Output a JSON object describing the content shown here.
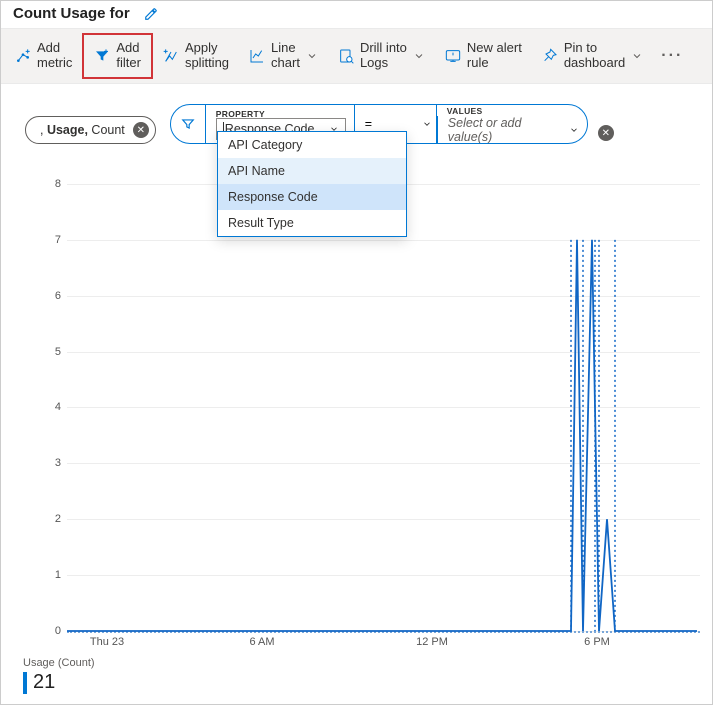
{
  "title": "Count Usage for",
  "toolbar": {
    "add_metric": "Add\nmetric",
    "add_filter": "Add\nfilter",
    "apply_splitting": "Apply\nsplitting",
    "line_chart": "Line\nchart",
    "drill_logs": "Drill into\nLogs",
    "new_alert": "New alert\nrule",
    "pin": "Pin to\ndashboard"
  },
  "existing_pill": {
    "prefix": ", ",
    "metric": "Usage,",
    "agg": " Count"
  },
  "filter": {
    "property_label": "PROPERTY",
    "property_value": "Response Code",
    "operator": "=",
    "values_label": "VALUES",
    "values_placeholder": "Select or add value(s)",
    "dropdown": [
      {
        "label": "API Category",
        "state": ""
      },
      {
        "label": "API Name",
        "state": "highlight"
      },
      {
        "label": "Response Code",
        "state": "selected"
      },
      {
        "label": "Result Type",
        "state": ""
      }
    ]
  },
  "chart_data": {
    "type": "line",
    "title": "",
    "xlabel": "",
    "ylabel": "",
    "ylim": [
      0,
      8.5
    ],
    "y_ticks": [
      0,
      1,
      2,
      3,
      4,
      5,
      6,
      7,
      8
    ],
    "x_ticks": [
      "Thu 23",
      "6 AM",
      "12 PM",
      "6 PM"
    ],
    "series": [
      {
        "name": "Usage (Count)",
        "x": [
          "Thu 23 00:00",
          "05:45 PM",
          "05:48 PM",
          "05:55 PM",
          "06:00 PM",
          "06:05 PM",
          "06:10 PM"
        ],
        "values": [
          0,
          0,
          7,
          0,
          7,
          0,
          2
        ]
      }
    ]
  },
  "legend": {
    "label": "Usage (Count)",
    "value": "21"
  }
}
